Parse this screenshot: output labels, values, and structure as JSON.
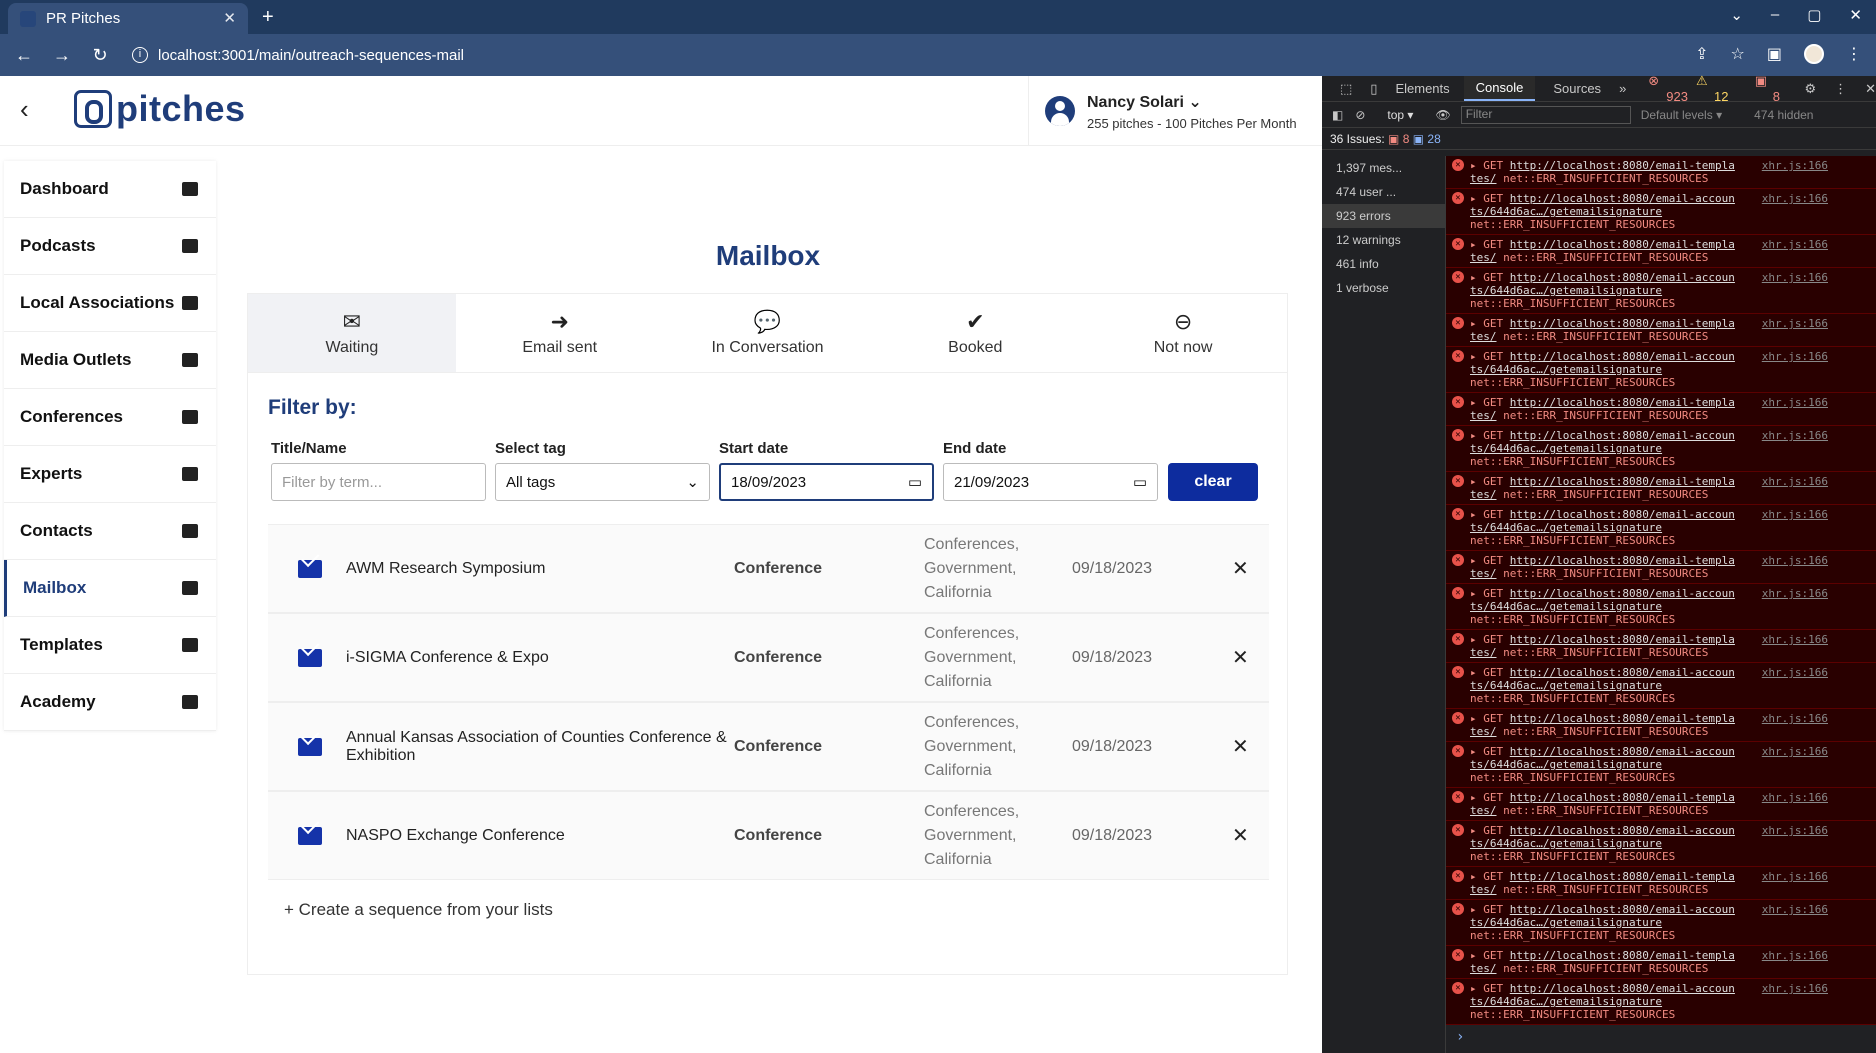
{
  "browser": {
    "tab_title": "PR Pitches",
    "url": "localhost:3001/main/outreach-sequences-mail"
  },
  "header": {
    "logo_text": "pitches",
    "user_name": "Nancy Solari",
    "user_sub": "255 pitches - 100 Pitches Per Month"
  },
  "sidebar": {
    "items": [
      {
        "label": "Dashboard",
        "icon": "home-icon"
      },
      {
        "label": "Podcasts",
        "icon": "podcast-icon"
      },
      {
        "label": "Local Associations",
        "icon": "calendar-icon"
      },
      {
        "label": "Media Outlets",
        "icon": "newspaper-icon"
      },
      {
        "label": "Conferences",
        "icon": "microphone-icon"
      },
      {
        "label": "Experts",
        "icon": "users-icon"
      },
      {
        "label": "Contacts",
        "icon": "list-icon"
      },
      {
        "label": "Mailbox",
        "icon": "envelope-icon"
      },
      {
        "label": "Templates",
        "icon": "file-icon"
      },
      {
        "label": "Academy",
        "icon": "graduation-cap-icon"
      }
    ]
  },
  "main": {
    "title": "Mailbox",
    "tabs": [
      {
        "label": "Waiting",
        "icon": "envelope-icon"
      },
      {
        "label": "Email sent",
        "icon": "arrow-circle-icon"
      },
      {
        "label": "In Conversation",
        "icon": "comments-icon"
      },
      {
        "label": "Booked",
        "icon": "check-circle-icon"
      },
      {
        "label": "Not now",
        "icon": "minus-circle-icon"
      }
    ],
    "filter": {
      "title": "Filter by:",
      "name_label": "Title/Name",
      "name_placeholder": "Filter by term...",
      "tag_label": "Select tag",
      "tag_value": "All tags",
      "start_label": "Start date",
      "start_value": "18/09/2023",
      "end_label": "End date",
      "end_value": "21/09/2023",
      "clear_label": "clear"
    },
    "rows": [
      {
        "title": "AWM Research Symposium",
        "type": "Conference",
        "tags": "Conferences, Government, California",
        "date": "09/18/2023"
      },
      {
        "title": "i-SIGMA Conference & Expo",
        "type": "Conference",
        "tags": "Conferences, Government, California",
        "date": "09/18/2023"
      },
      {
        "title": "Annual Kansas Association of Counties Conference & Exhibition",
        "type": "Conference",
        "tags": "Conferences, Government, California",
        "date": "09/18/2023"
      },
      {
        "title": "NASPO Exchange Conference",
        "type": "Conference",
        "tags": "Conferences, Government, California",
        "date": "09/18/2023"
      }
    ],
    "create_link": "+ Create a sequence from your lists"
  },
  "devtools": {
    "tabs": [
      "Elements",
      "Console",
      "Sources"
    ],
    "error_count": "923",
    "warning_count": "12",
    "issue_badge": "8",
    "context": "top",
    "filter_placeholder": "Filter",
    "levels": "Default levels",
    "hidden": "474 hidden",
    "issues": "36 Issues:",
    "issues_err": "8",
    "issues_info": "28",
    "side": [
      "1,397 mes...",
      "474 user ...",
      "923 errors",
      "12 warnings",
      "461 info",
      "1 verbose"
    ],
    "log_a_url": "http://localhost:8080/email-templa",
    "log_a_rest": "tes/",
    "log_b_url": "http://localhost:8080/email-accoun",
    "log_b_rest": "ts/644d6ac…/getemailsignature",
    "log_error": "net::ERR_INSUFFICIENT_RESOURCES",
    "log_src": "xhr.js:166"
  }
}
